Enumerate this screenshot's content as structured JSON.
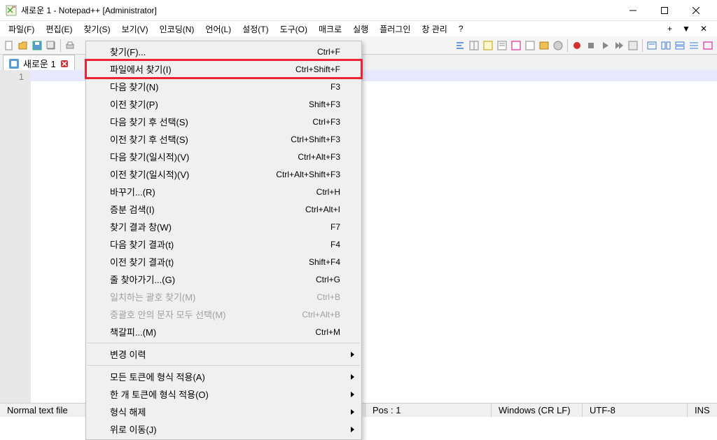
{
  "window": {
    "title": "새로운 1 - Notepad++ [Administrator]"
  },
  "menubar": {
    "items": [
      "파일(F)",
      "편집(E)",
      "찾기(S)",
      "보기(V)",
      "인코딩(N)",
      "언어(L)",
      "설정(T)",
      "도구(O)",
      "매크로",
      "실행",
      "플러그인",
      "창 관리",
      "?"
    ],
    "right": [
      "+",
      "▼",
      "✕"
    ]
  },
  "tab": {
    "label": "새로운 1"
  },
  "gutter": {
    "line1": "1"
  },
  "dropdown": {
    "items": [
      {
        "label": "찾기(F)...",
        "shortcut": "Ctrl+F",
        "type": "item"
      },
      {
        "label": "파일에서 찾기(I)",
        "shortcut": "Ctrl+Shift+F",
        "type": "item",
        "highlight": true
      },
      {
        "label": "다음 찾기(N)",
        "shortcut": "F3",
        "type": "item"
      },
      {
        "label": "이전 찾기(P)",
        "shortcut": "Shift+F3",
        "type": "item"
      },
      {
        "label": "다음 찾기 후 선택(S)",
        "shortcut": "Ctrl+F3",
        "type": "item"
      },
      {
        "label": "이전 찾기 후 선택(S)",
        "shortcut": "Ctrl+Shift+F3",
        "type": "item"
      },
      {
        "label": "다음 찾기(일시적)(V)",
        "shortcut": "Ctrl+Alt+F3",
        "type": "item"
      },
      {
        "label": "이전 찾기(일시적)(V)",
        "shortcut": "Ctrl+Alt+Shift+F3",
        "type": "item"
      },
      {
        "label": "바꾸기...(R)",
        "shortcut": "Ctrl+H",
        "type": "item"
      },
      {
        "label": "증분 검색(I)",
        "shortcut": "Ctrl+Alt+I",
        "type": "item"
      },
      {
        "label": "찾기 결과 창(W)",
        "shortcut": "F7",
        "type": "item"
      },
      {
        "label": "다음 찾기 결과(t)",
        "shortcut": "F4",
        "type": "item"
      },
      {
        "label": "이전 찾기 결과(t)",
        "shortcut": "Shift+F4",
        "type": "item"
      },
      {
        "label": "줄 찾아가기...(G)",
        "shortcut": "Ctrl+G",
        "type": "item"
      },
      {
        "label": "일치하는 괄호 찾기(M)",
        "shortcut": "Ctrl+B",
        "type": "item",
        "disabled": true
      },
      {
        "label": "중괄호 안의 문자 모두 선택(M)",
        "shortcut": "Ctrl+Alt+B",
        "type": "item",
        "disabled": true
      },
      {
        "label": "책갈피...(M)",
        "shortcut": "Ctrl+M",
        "type": "item"
      },
      {
        "type": "sep"
      },
      {
        "label": "변경 이력",
        "shortcut": "",
        "type": "sub"
      },
      {
        "type": "sep"
      },
      {
        "label": "모든 토큰에 형식 적용(A)",
        "shortcut": "",
        "type": "sub"
      },
      {
        "label": "한 개 토큰에 형식 적용(O)",
        "shortcut": "",
        "type": "sub"
      },
      {
        "label": "형식 해제",
        "shortcut": "",
        "type": "sub"
      },
      {
        "label": "위로 이동(J)",
        "shortcut": "",
        "type": "sub"
      }
    ]
  },
  "statusbar": {
    "filetype": "Normal text file",
    "pos": "Pos : 1",
    "eol": "Windows (CR LF)",
    "encoding": "UTF-8",
    "ins": "INS"
  },
  "colors": {
    "accent": "#5b9bd5",
    "highlight_border": "#e23"
  }
}
